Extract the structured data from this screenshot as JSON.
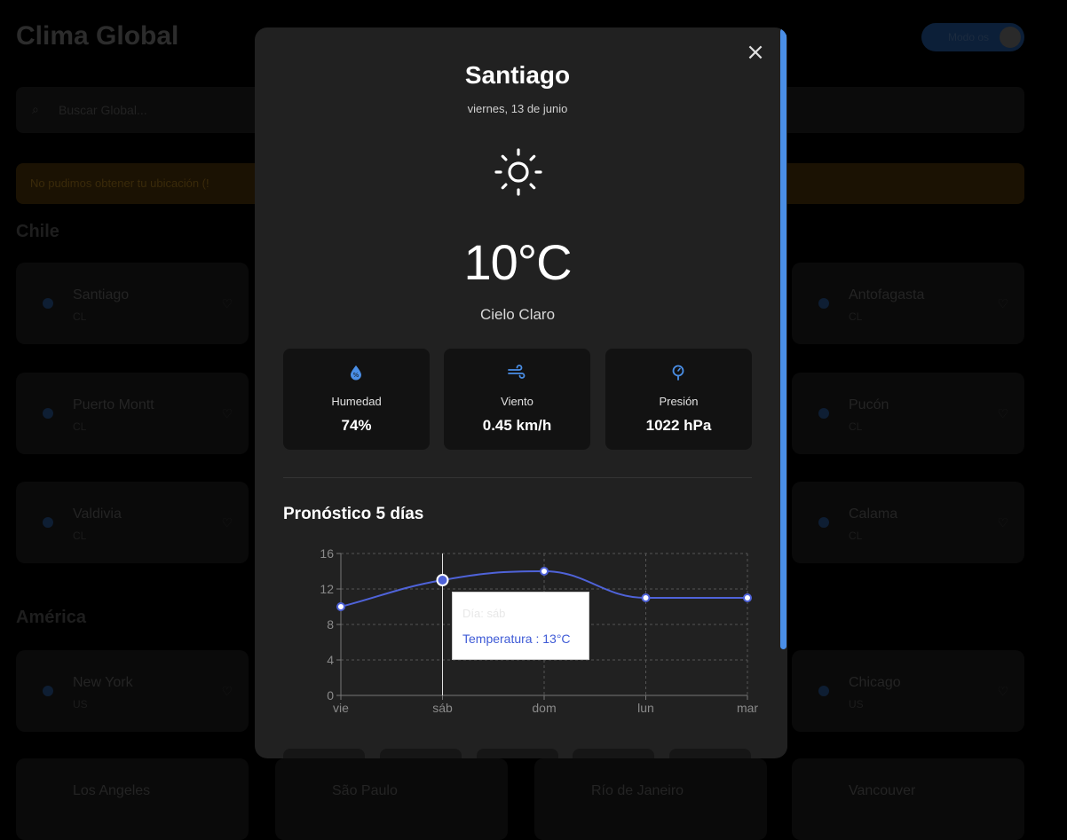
{
  "background": {
    "app_title": "Clima Global",
    "theme_toggle_label": "Modo os",
    "search_placeholder": "Buscar Global...",
    "alert_text": "No pudimos obtener tu ubicación (!",
    "sections": [
      {
        "title": "Chile"
      },
      {
        "title": "América"
      }
    ],
    "cards": [
      {
        "name": "Santiago",
        "code": "CL"
      },
      {
        "name": "Antofagasta",
        "code": "CL"
      },
      {
        "name": "Puerto Montt",
        "code": "CL"
      },
      {
        "name": "Pucón",
        "code": "CL"
      },
      {
        "name": "Valdivia",
        "code": "CL"
      },
      {
        "name": "Calama",
        "code": "CL"
      },
      {
        "name": "New York",
        "code": "US"
      },
      {
        "name": "Chicago",
        "code": "US"
      },
      {
        "name": "Los Angeles",
        "code": ""
      },
      {
        "name": "São Paulo",
        "code": ""
      },
      {
        "name": "Río de Janeiro",
        "code": ""
      },
      {
        "name": "Vancouver",
        "code": ""
      }
    ]
  },
  "modal": {
    "close_icon": "×",
    "city": "Santiago",
    "date": "viernes, 13 de junio",
    "weather_icon": "sun-icon",
    "temperature": "10°C",
    "condition": "Cielo Claro",
    "stats": [
      {
        "label": "Humedad",
        "value": "74%",
        "icon": "humidity-icon"
      },
      {
        "label": "Viento",
        "value": "0.45 km/h",
        "icon": "wind-icon"
      },
      {
        "label": "Presión",
        "value": "1022 hPa",
        "icon": "pressure-icon"
      }
    ],
    "forecast_title": "Pronóstico 5 días",
    "tooltip": {
      "label": "Día: sáb",
      "value": "Temperatura : 13°C"
    },
    "accent_color": "#4a8ee6",
    "line_color": "#4f63d9"
  },
  "chart_data": {
    "type": "line",
    "categories": [
      "vie",
      "sáb",
      "dom",
      "lun",
      "mar"
    ],
    "values": [
      10,
      13,
      14,
      11,
      11
    ],
    "ylim": [
      0,
      16
    ],
    "yticks": [
      0,
      4,
      8,
      12,
      16
    ],
    "grid": true,
    "active_index": 1
  }
}
